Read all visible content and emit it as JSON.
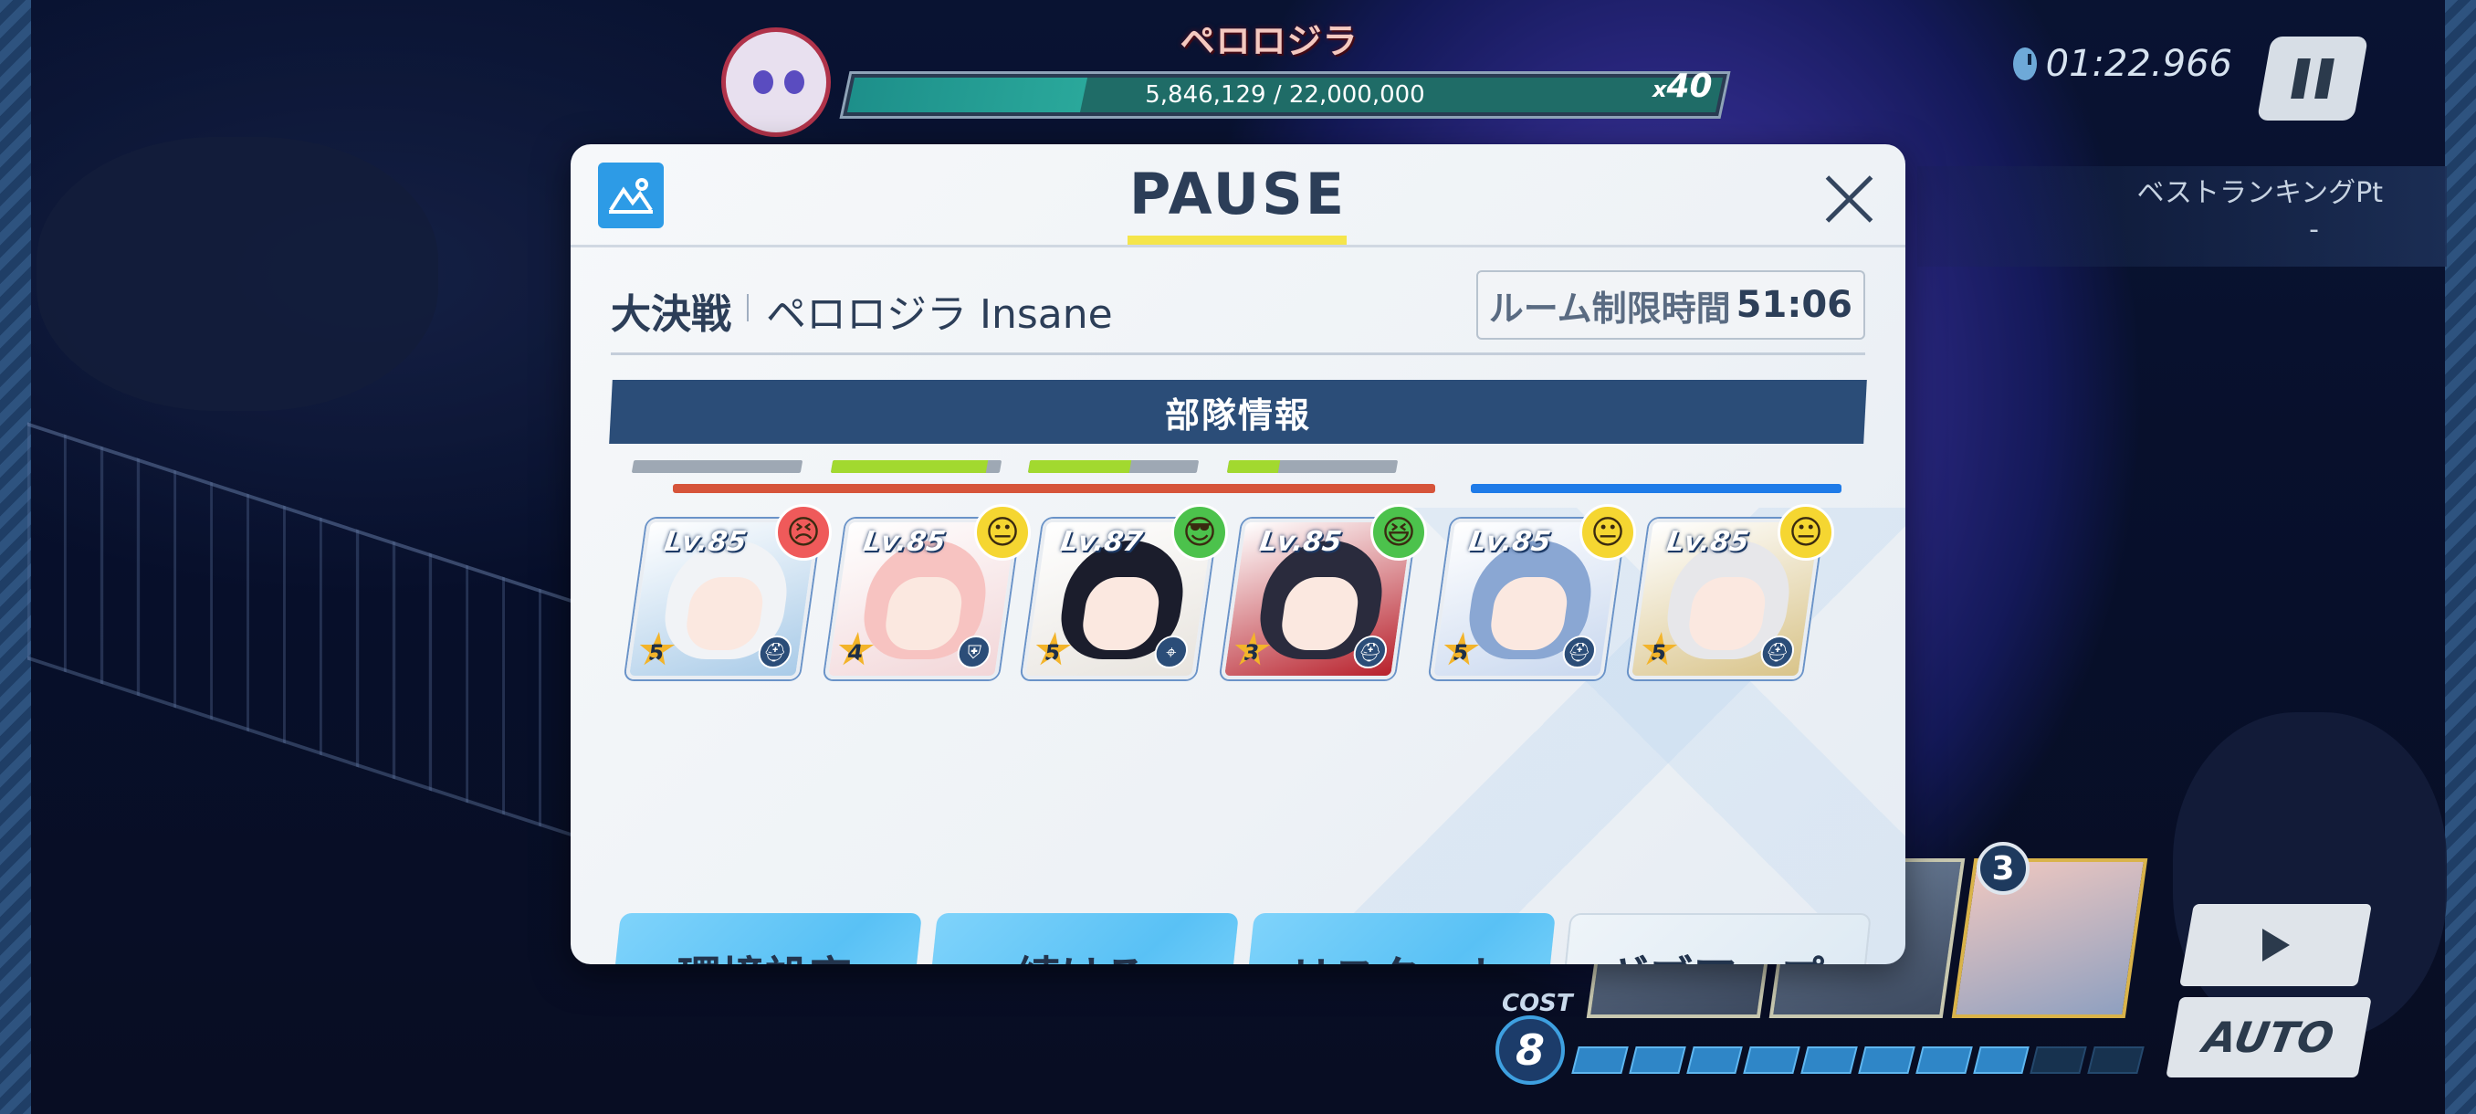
{
  "hud": {
    "boss_name": "ペロロジラ",
    "hp_text": "5,846,129 / 22,000,000",
    "hp_fraction": 0.266,
    "hp_multiplier_prefix": "x",
    "hp_multiplier": "40",
    "timer": "01:22.966",
    "rank_label": "ベストランキングPt",
    "rank_value": "-",
    "cost_label": "COST",
    "cost_value": "8",
    "next_card_cost": "3",
    "auto_label": "AUTO"
  },
  "dialog": {
    "title": "PAUSE",
    "mode": "大決戦",
    "stage": "ペロロジラ Insane",
    "room_time_label": "ルーム制限時間",
    "room_time_value": "51:06",
    "squad_header": "部隊情報",
    "striker_units": [
      {
        "level": "Lv.85",
        "star": "5",
        "mood": "angry",
        "mood_glyph": "😣",
        "role_glyph": "⛑",
        "hp": 0.0,
        "colors": {
          "hair": "#f1f3f6",
          "bg": "#a9cbe8"
        }
      },
      {
        "level": "Lv.85",
        "star": "4",
        "mood": "neutral",
        "mood_glyph": "😐",
        "role_glyph": "⛨",
        "hp": 0.92,
        "colors": {
          "hair": "#f7c3c1",
          "bg": "#f2d6d8"
        }
      },
      {
        "level": "Lv.87",
        "star": "5",
        "mood": "cool",
        "mood_glyph": "😎",
        "role_glyph": "⌖",
        "hp": 0.6,
        "colors": {
          "hair": "#1b1d2c",
          "bg": "#e8e4de"
        }
      },
      {
        "level": "Lv.85",
        "star": "3",
        "mood": "happy",
        "mood_glyph": "😆",
        "role_glyph": "⛑",
        "hp": 0.3,
        "colors": {
          "hair": "#2a2b3d",
          "bg": "#b8212c"
        }
      }
    ],
    "special_units": [
      {
        "level": "Lv.85",
        "star": "5",
        "mood": "neutral",
        "mood_glyph": "😐",
        "role_glyph": "⛑",
        "colors": {
          "hair": "#8aa7d3",
          "bg": "#c9d8ef"
        }
      },
      {
        "level": "Lv.85",
        "star": "5",
        "mood": "neutral",
        "mood_glyph": "😐",
        "role_glyph": "⛑",
        "colors": {
          "hair": "#e7e7ea",
          "bg": "#d9c48a"
        }
      }
    ],
    "buttons": {
      "settings": "環境設定",
      "continue": "続ける",
      "restart": "リスタート",
      "give_up": "ギブアップ"
    }
  },
  "colors": {
    "striker_line": "#d6543a",
    "special_line": "#1e7be8",
    "button_primary": "#59c1f5",
    "banner": "#2b4d78"
  }
}
